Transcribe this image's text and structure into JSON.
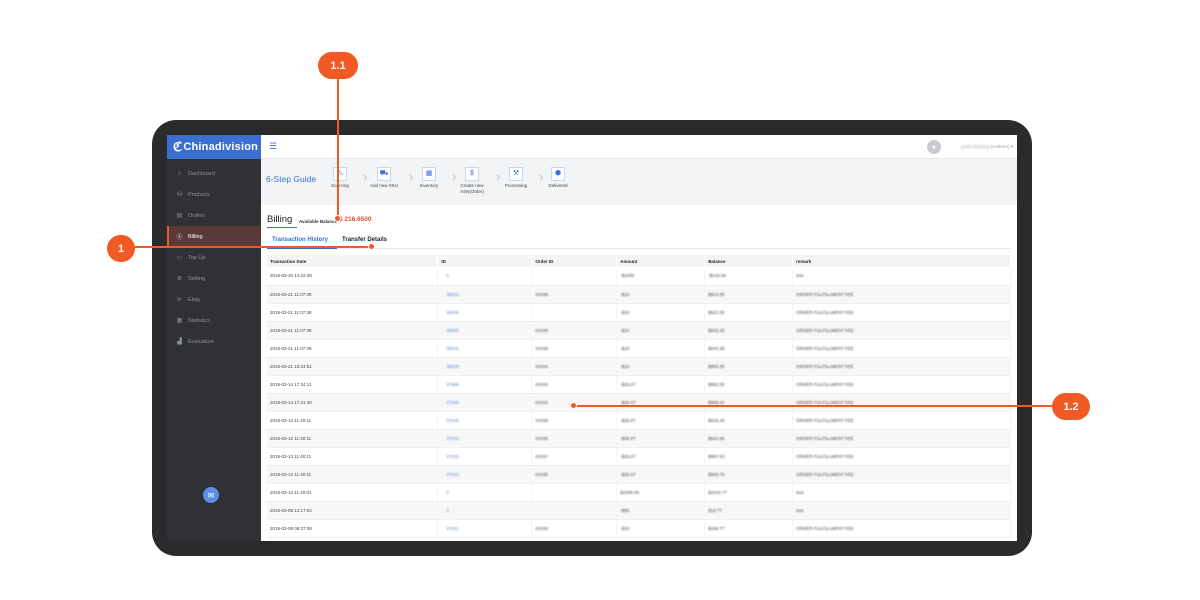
{
  "app": {
    "logo": "Chinadivision",
    "user_name": "guan zhiqiang",
    "user_account": "(cnstorm)"
  },
  "sidebar": {
    "items": [
      {
        "label": "Dashboard",
        "icon": "dashboard-icon",
        "active": false
      },
      {
        "label": "Products",
        "icon": "products-icon",
        "active": false
      },
      {
        "label": "Orders",
        "icon": "orders-icon",
        "active": false
      },
      {
        "label": "Billing",
        "icon": "billing-icon",
        "active": true
      },
      {
        "label": "Top Up",
        "icon": "topup-icon",
        "active": false
      },
      {
        "label": "Setting",
        "icon": "gear-icon",
        "active": false
      },
      {
        "label": "Ebay",
        "icon": "ebay-icon",
        "active": false
      },
      {
        "label": "Statistics",
        "icon": "statistics-icon",
        "active": false
      },
      {
        "label": "Evaluation",
        "icon": "evaluation-icon",
        "active": false
      }
    ]
  },
  "guide": {
    "title": "6-Step Guide",
    "steps": [
      {
        "label": "Sourcing",
        "icon": "cart-icon"
      },
      {
        "label": "Add new SKU",
        "icon": "truck-icon"
      },
      {
        "label": "Inventory",
        "icon": "inventory-icon"
      },
      {
        "label": "Create new ASN(Order)",
        "icon": "moneybag-icon"
      },
      {
        "label": "Processing",
        "icon": "forklift-icon"
      },
      {
        "label": "Delivered",
        "icon": "box-icon"
      }
    ]
  },
  "billing": {
    "title": "Billing",
    "available_label": "Available Balance",
    "available_value": "$ 216.6500",
    "tabs": [
      "Transaction History",
      "Transfer Details"
    ]
  },
  "table": {
    "columns": [
      "Transaction Date",
      "ID",
      "Order ID",
      "Amount",
      "Balance",
      "remark"
    ],
    "rows": [
      [
        "2019-03-25 14:22:28",
        "0",
        "",
        "-$1030",
        "-$216.65",
        "test"
      ],
      [
        "2019-03-21 11:07:39",
        "38032",
        "#1048",
        "-$10",
        "$813.35",
        "ORDER FULFILLMENT FEE"
      ],
      [
        "2019-03-21 11:07:39",
        "38030",
        "",
        "-$10",
        "$823.35",
        "ORDER FULFILLMENT FEE"
      ],
      [
        "2019-03-21 11:07:39",
        "38030",
        "#1046",
        "-$10",
        "$833.35",
        "ORDER FULFILLMENT FEE"
      ],
      [
        "2019-03-21 11:07:39",
        "38032",
        "#1049",
        "-$10",
        "$843.35",
        "ORDER FULFILLMENT FEE"
      ],
      [
        "2019-03-21 10:24:51",
        "38028",
        "#1044",
        "-$10",
        "$853.35",
        "ORDER FULFILLMENT FEE"
      ],
      [
        "2019-03-14 17:24:11",
        "37908",
        "#1043",
        "-$26.07",
        "$863.35",
        "ORDER FULFILLMENT FEE"
      ],
      [
        "2019-03-14 17:21:40",
        "37906",
        "#1042",
        "-$26.07",
        "$889.42",
        "ORDER FULFILLMENT FEE"
      ],
      [
        "2019-03-12 11:40:11",
        "37245",
        "#1038",
        "-$26.07",
        "$915.49",
        "ORDER FULFILLMENT FEE"
      ],
      [
        "2019-03-12 11:40:11",
        "37243",
        "#1036",
        "-$26.07",
        "$941.56",
        "ORDER FULFILLMENT FEE"
      ],
      [
        "2019-03-12 11:40:11",
        "37243",
        "#1037",
        "-$26.07",
        "$967.63",
        "ORDER FULFILLMENT FEE"
      ],
      [
        "2019-03-12 11:40:11",
        "37243",
        "#1035",
        "-$26.07",
        "$993.70",
        "ORDER FULFILLMENT FEE"
      ],
      [
        "2019-03-12 11:40:01",
        "0",
        "",
        "$1000.00",
        "$1019.77",
        "test"
      ],
      [
        "2019-03-08 14:17:02",
        "0",
        "",
        "-$90",
        "$19.77",
        "test"
      ],
      [
        "2019-03-08 09:27:08",
        "37021",
        "#1030",
        "-$10",
        "$109.77",
        "ORDER FULFILLMENT FEE"
      ]
    ]
  },
  "callouts": {
    "c1": "1",
    "c11": "1.1",
    "c12": "1.2"
  },
  "colors": {
    "brand_blue": "#3a6fd1",
    "callout_orange": "#f15a24",
    "balance_red": "#e14b2a"
  }
}
